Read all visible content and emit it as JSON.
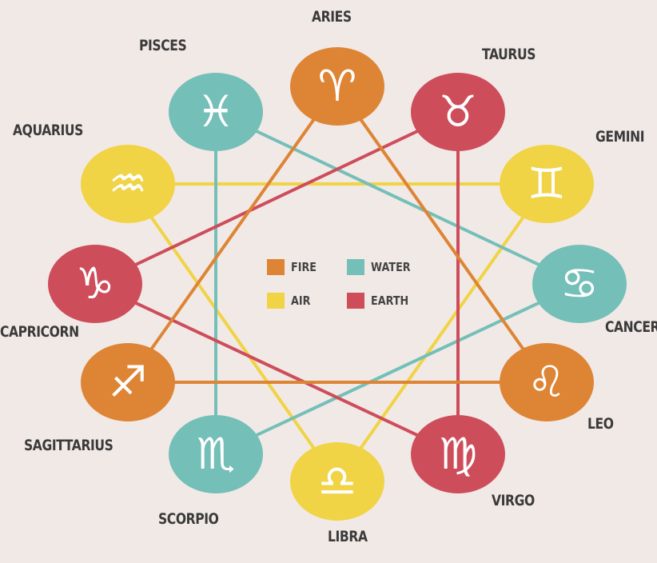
{
  "colors": {
    "background": "#f1e9e6",
    "fire": "#de8435",
    "water": "#74bfb8",
    "air": "#f1d346",
    "earth": "#cd4d5b",
    "label": "#3a3a3a"
  },
  "legend": [
    {
      "key": "fire",
      "label": "FIRE"
    },
    {
      "key": "water",
      "label": "WATER"
    },
    {
      "key": "air",
      "label": "AIR"
    },
    {
      "key": "earth",
      "label": "EARTH"
    }
  ],
  "signs": [
    {
      "id": "aries",
      "name": "ARIES",
      "symbol": "♈",
      "element": "fire"
    },
    {
      "id": "taurus",
      "name": "TAURUS",
      "symbol": "♉",
      "element": "earth"
    },
    {
      "id": "gemini",
      "name": "GEMINI",
      "symbol": "♊",
      "element": "air"
    },
    {
      "id": "cancer",
      "name": "CANCER",
      "symbol": "♋",
      "element": "water"
    },
    {
      "id": "leo",
      "name": "LEO",
      "symbol": "♌",
      "element": "fire"
    },
    {
      "id": "virgo",
      "name": "VIRGO",
      "symbol": "♍",
      "element": "earth"
    },
    {
      "id": "libra",
      "name": "LIBRA",
      "symbol": "♎",
      "element": "air"
    },
    {
      "id": "scorpio",
      "name": "SCORPIO",
      "symbol": "♏",
      "element": "water"
    },
    {
      "id": "sagittarius",
      "name": "SAGITTARIUS",
      "symbol": "♐",
      "element": "fire"
    },
    {
      "id": "capricorn",
      "name": "CAPRICORN",
      "symbol": "♑",
      "element": "earth"
    },
    {
      "id": "aquarius",
      "name": "AQUARIUS",
      "symbol": "♒",
      "element": "air"
    },
    {
      "id": "pisces",
      "name": "PISCES",
      "symbol": "♓",
      "element": "water"
    }
  ]
}
